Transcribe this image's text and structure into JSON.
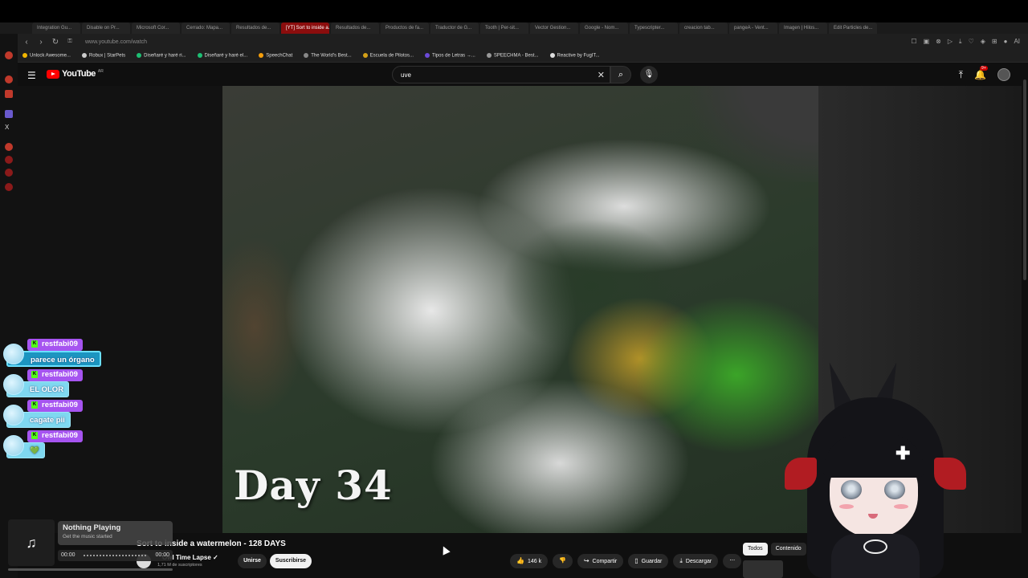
{
  "browser": {
    "tabs": [
      "Integration Gu...",
      "Disable on Pr...",
      "Microsoft Cor...",
      "Cerrado: Mapa...",
      "Resultados de...",
      "[YT] Sort to inside a...",
      "Resultados de...",
      "Productos de fa...",
      "Traductor de G...",
      "Tooth | Per-sit...",
      "Vector Gestion...",
      "Google - Nom...",
      "Typescripter...",
      "creacion tab...",
      "pangeA - Vent...",
      "Imagen | Hilos...",
      "Edit Particles de..."
    ],
    "active_tab_index": 5,
    "url": "www.youtube.com/watch",
    "bookmarks": [
      {
        "label": "Unlock Awesome...",
        "color": "#f2b600"
      },
      {
        "label": "Robux | StarPets",
        "color": "#cccccc"
      },
      {
        "label": "Diseñaré y haré ri...",
        "color": "#1dbf73"
      },
      {
        "label": "Diseñaré y haré el...",
        "color": "#1dbf73"
      },
      {
        "label": "SpeechChat",
        "color": "#f59e0b"
      },
      {
        "label": "The World's Best...",
        "color": "#888888"
      },
      {
        "label": "Escuela de Pilotos...",
        "color": "#d4a017"
      },
      {
        "label": "Tipos de Letras →...",
        "color": "#6c4ad8"
      },
      {
        "label": "SPEECHMA - Best...",
        "color": "#999999"
      },
      {
        "label": "Reactive by FugIT...",
        "color": "#dddddd"
      }
    ]
  },
  "youtube": {
    "logo_text": "YouTube",
    "logo_suffix": "AR",
    "search_value": "uve",
    "notification_count": "9+",
    "video": {
      "overlay_text": "Day 34",
      "title": "Sort to inside a watermelon - 128 DAYS",
      "channel_name": "Owl Time Lapse",
      "subscribers": "1,71 M de suscriptores",
      "join_label": "Unirse",
      "subscribe_label": "Suscribirse",
      "likes": "146 k",
      "share_label": "Compartir",
      "save_label": "Guardar",
      "download_label": "Descargar"
    },
    "chips": [
      "Todos",
      "Contenido"
    ]
  },
  "chat": [
    {
      "user": "restfabi09",
      "message": "parece un órgano"
    },
    {
      "user": "restfabi09",
      "message": "EL OLOR"
    },
    {
      "user": "restfabi09",
      "message": "cagate pii"
    },
    {
      "user": "restfabi09",
      "message": "💚"
    }
  ],
  "music_widget": {
    "title": "Nothing Playing",
    "subtitle": "Get the music started",
    "time_start": "00:00",
    "time_end": "00:00",
    "progress": 0
  },
  "colors": {
    "accent": "#ff0000",
    "chat_name_bg": "#a654f0",
    "chat_msg_bg": "#7fd8f0",
    "kick_green": "#53fc18"
  }
}
